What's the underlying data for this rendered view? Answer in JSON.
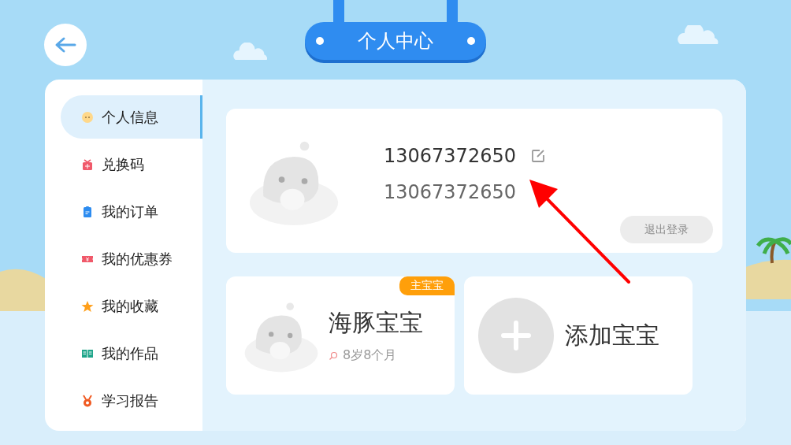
{
  "header": {
    "title": "个人中心"
  },
  "sidebar": {
    "items": [
      {
        "label": "个人信息",
        "selected": true
      },
      {
        "label": "兑换码",
        "selected": false
      },
      {
        "label": "我的订单",
        "selected": false
      },
      {
        "label": "我的优惠券",
        "selected": false
      },
      {
        "label": "我的收藏",
        "selected": false
      },
      {
        "label": "我的作品",
        "selected": false
      },
      {
        "label": "学习报告",
        "selected": false
      }
    ]
  },
  "profile": {
    "name": "13067372650",
    "phone": "13067372650",
    "logout_button": "退出登录"
  },
  "babies": [
    {
      "kind": "baby",
      "name": "海豚宝宝",
      "age": "8岁8个月",
      "badge": "主宝宝"
    },
    {
      "kind": "add",
      "name": "添加宝宝"
    }
  ]
}
